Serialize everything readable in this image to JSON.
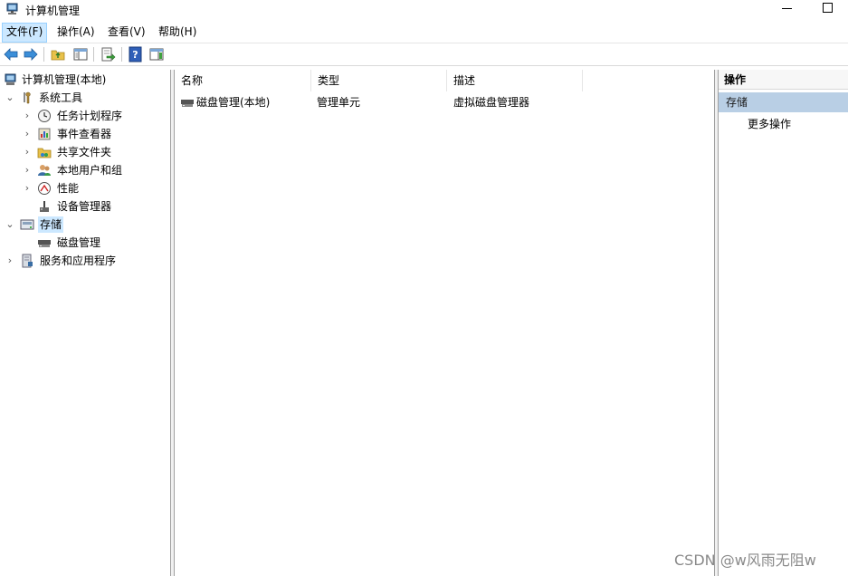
{
  "window": {
    "title": "计算机管理"
  },
  "menu": [
    "文件(F)",
    "操作(A)",
    "查看(V)",
    "帮助(H)"
  ],
  "tree": {
    "root": "计算机管理(本地)",
    "system_tools": "系统工具",
    "task_scheduler": "任务计划程序",
    "event_viewer": "事件查看器",
    "shared_folders": "共享文件夹",
    "local_users": "本地用户和组",
    "performance": "性能",
    "device_manager": "设备管理器",
    "storage": "存储",
    "disk_management": "磁盘管理",
    "services_apps": "服务和应用程序"
  },
  "list": {
    "columns": [
      "名称",
      "类型",
      "描述"
    ],
    "rows": [
      {
        "name": "磁盘管理(本地)",
        "type": "管理单元",
        "desc": "虚拟磁盘管理器"
      }
    ]
  },
  "actions": {
    "header": "操作",
    "section": "存储",
    "more": "更多操作"
  },
  "watermark": "CSDN @w风雨无阻w"
}
